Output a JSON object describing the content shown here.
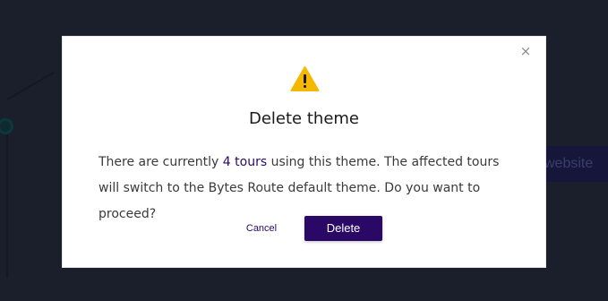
{
  "background": {
    "button_label": "website"
  },
  "modal": {
    "close_symbol": "×",
    "icon": "warning-icon",
    "title": "Delete theme",
    "message_prefix": "There are currently ",
    "message_highlight": "4 tours",
    "message_suffix": " using this theme. The affected tours will switch to the Bytes Route default theme. Do you want to proceed?",
    "cancel_label": "Cancel",
    "delete_label": "Delete"
  },
  "colors": {
    "brand": "#2a0866",
    "warning": "#f5b800",
    "overlay": "#1b1f2b"
  }
}
